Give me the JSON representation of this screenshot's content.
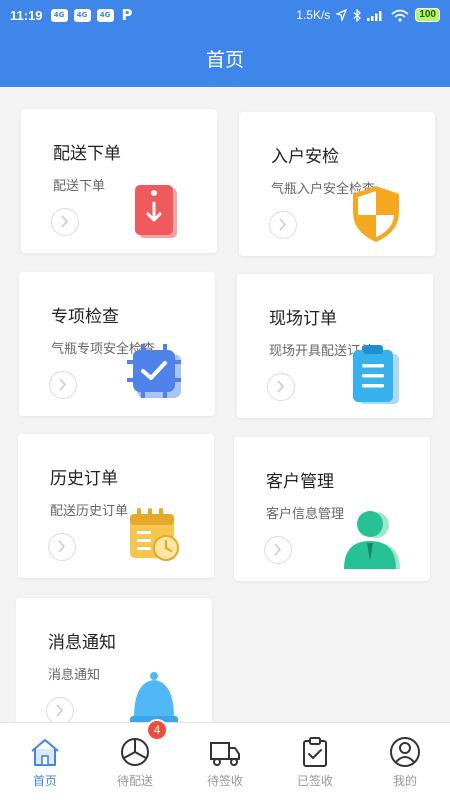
{
  "status_bar": {
    "time": "11:19",
    "app_icons": [
      "4G",
      "4G",
      "4G"
    ],
    "speed": "1.5K/s",
    "battery": "100"
  },
  "header": {
    "title": "首页"
  },
  "cards": [
    {
      "title": "配送下单",
      "subtitle": "配送下单",
      "icon": "tag-download-icon"
    },
    {
      "title": "入户安检",
      "subtitle": "气瓶入户安全检查",
      "icon": "shield-icon"
    },
    {
      "title": "专项检查",
      "subtitle": "气瓶专项安全检查",
      "icon": "check-chip-icon"
    },
    {
      "title": "现场订单",
      "subtitle": "现场开具配送订单",
      "icon": "clipboard-icon"
    },
    {
      "title": "历史订单",
      "subtitle": "配送历史订单",
      "icon": "calendar-clock-icon"
    },
    {
      "title": "客户管理",
      "subtitle": "客户信息管理",
      "icon": "customer-icon"
    },
    {
      "title": "消息通知",
      "subtitle": "消息通知",
      "icon": "bell-icon"
    }
  ],
  "tabs": [
    {
      "label": "首页",
      "icon": "home-icon",
      "active": true
    },
    {
      "label": "待配送",
      "icon": "pending-delivery-icon",
      "badge": "4"
    },
    {
      "label": "待签收",
      "icon": "truck-icon"
    },
    {
      "label": "已签收",
      "icon": "signed-clipboard-icon"
    },
    {
      "label": "我的",
      "icon": "user-icon"
    }
  ],
  "colors": {
    "primary": "#3f86ea",
    "badge": "#f14b3d",
    "tab_inactive": "#999999"
  }
}
